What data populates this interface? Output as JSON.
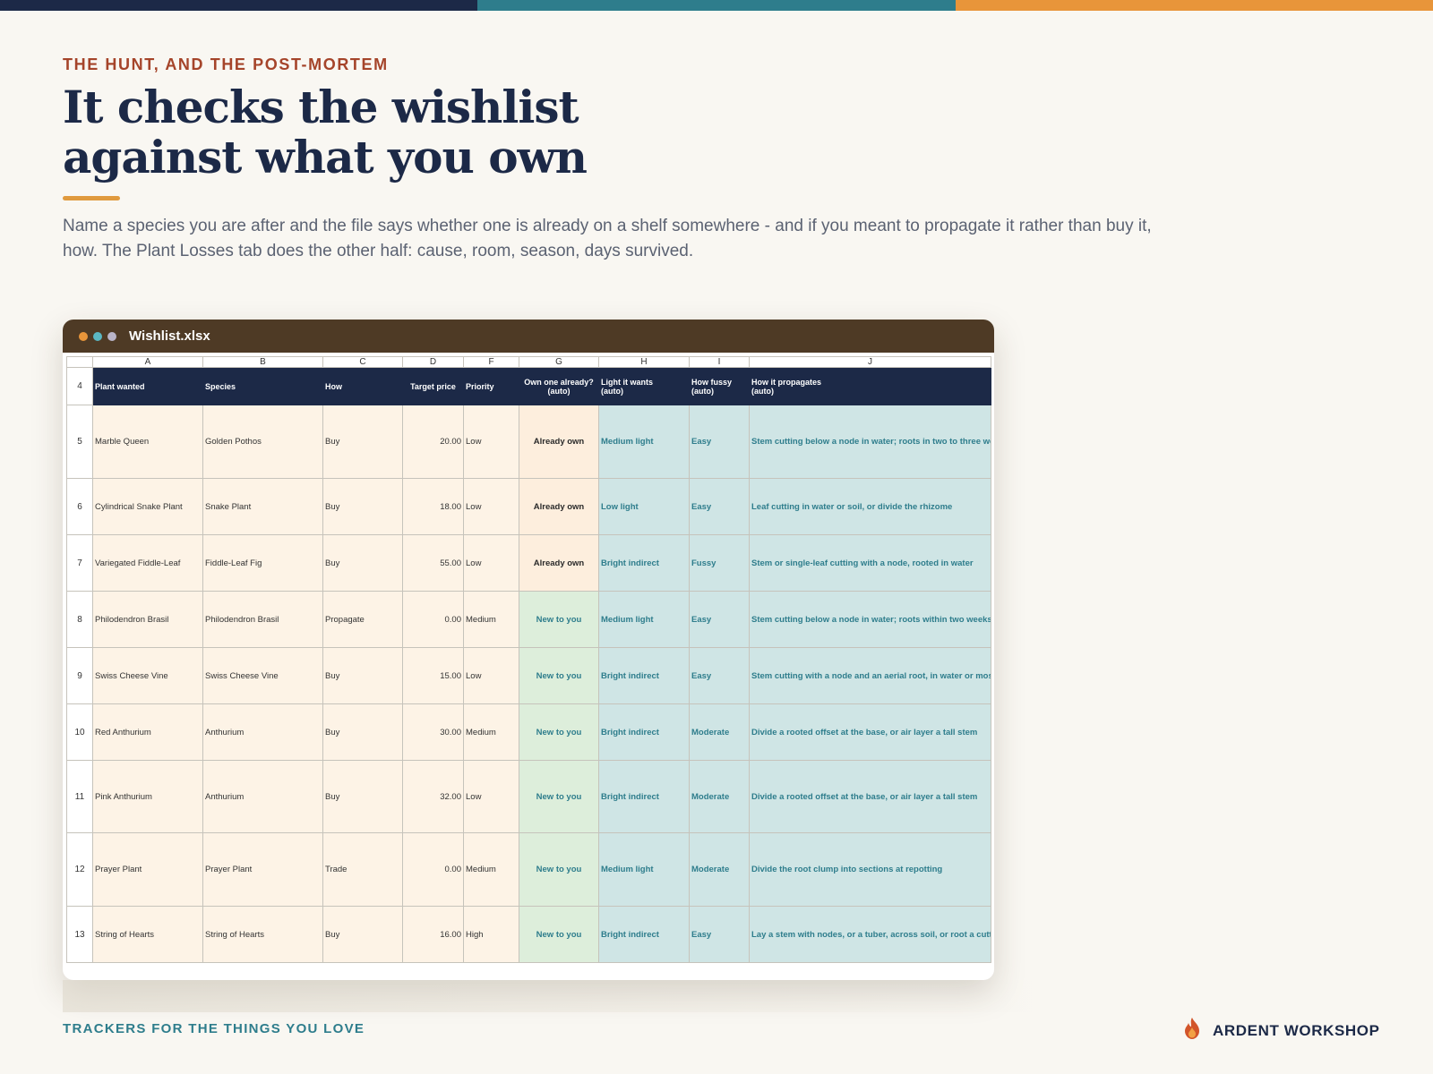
{
  "header": {
    "eyebrow": "THE HUNT, AND THE POST-MORTEM",
    "title_line1": "It checks the wishlist",
    "title_line2": "against what you own",
    "lead": "Name a species you are after and the file says whether one is already on a shelf somewhere - and if you meant to propagate it rather than buy it, how. The Plant Losses tab does the other half: cause, room, season, days survived."
  },
  "colors": {
    "navy": "#1c2947",
    "teal": "#2e7d8c",
    "orange": "#e8953a",
    "rust": "#a5442a",
    "titlebar": "#4e3a25"
  },
  "window": {
    "title": "Wishlist.xlsx",
    "dots": [
      "#e8953a",
      "#5bb8c4",
      "#b9b4c8"
    ]
  },
  "sheet": {
    "col_letters": [
      "A",
      "B",
      "C",
      "D",
      "F",
      "G",
      "H",
      "I",
      "J"
    ],
    "header_row_number": "4",
    "headers": [
      "Plant wanted",
      "Species",
      "How",
      "Target price",
      "Priority",
      "Own one already?\n(auto)",
      "Light it wants\n(auto)",
      "How fussy\n(auto)",
      "How it propagates\n(auto)"
    ],
    "rows": [
      {
        "n": "5",
        "plant": "Marble Queen",
        "species": "Golden Pothos",
        "how": "Buy",
        "price": "20.00",
        "priority": "Low",
        "own": "Already own",
        "light": "Medium light",
        "fussy": "Easy",
        "propagates": "Stem cutting below a node in water; roots in two to three weeks"
      },
      {
        "n": "6",
        "plant": "Cylindrical Snake Plant",
        "species": "Snake Plant",
        "how": "Buy",
        "price": "18.00",
        "priority": "Low",
        "own": "Already own",
        "light": "Low light",
        "fussy": "Easy",
        "propagates": "Leaf cutting in water or soil, or divide the rhizome"
      },
      {
        "n": "7",
        "plant": "Variegated Fiddle-Leaf",
        "species": "Fiddle-Leaf Fig",
        "how": "Buy",
        "price": "55.00",
        "priority": "Low",
        "own": "Already own",
        "light": "Bright indirect",
        "fussy": "Fussy",
        "propagates": "Stem or single-leaf cutting with a node, rooted in water"
      },
      {
        "n": "8",
        "plant": "Philodendron Brasil",
        "species": "Philodendron Brasil",
        "how": "Propagate",
        "price": "0.00",
        "priority": "Medium",
        "own": "New to you",
        "light": "Medium light",
        "fussy": "Easy",
        "propagates": "Stem cutting below a node in water; roots within two weeks"
      },
      {
        "n": "9",
        "plant": "Swiss Cheese Vine",
        "species": "Swiss Cheese Vine",
        "how": "Buy",
        "price": "15.00",
        "priority": "Low",
        "own": "New to you",
        "light": "Bright indirect",
        "fussy": "Easy",
        "propagates": "Stem cutting with a node and an aerial root, in water or moss"
      },
      {
        "n": "10",
        "plant": "Red Anthurium",
        "species": "Anthurium",
        "how": "Buy",
        "price": "30.00",
        "priority": "Medium",
        "own": "New to you",
        "light": "Bright indirect",
        "fussy": "Moderate",
        "propagates": "Divide a rooted offset at the base, or air layer a tall stem"
      },
      {
        "n": "11",
        "plant": "Pink Anthurium",
        "species": "Anthurium",
        "how": "Buy",
        "price": "32.00",
        "priority": "Low",
        "own": "New to you",
        "light": "Bright indirect",
        "fussy": "Moderate",
        "propagates": "Divide a rooted offset at the base, or air layer a tall stem"
      },
      {
        "n": "12",
        "plant": "Prayer Plant",
        "species": "Prayer Plant",
        "how": "Trade",
        "price": "0.00",
        "priority": "Medium",
        "own": "New to you",
        "light": "Medium light",
        "fussy": "Moderate",
        "propagates": "Divide the root clump into sections at repotting"
      },
      {
        "n": "13",
        "plant": "String of Hearts",
        "species": "String of Hearts",
        "how": "Buy",
        "price": "16.00",
        "priority": "High",
        "own": "New to you",
        "light": "Bright indirect",
        "fussy": "Easy",
        "propagates": "Lay a stem with nodes, or a tuber, across soil, or root a cutting i"
      }
    ]
  },
  "footer": {
    "tagline": "TRACKERS FOR THE THINGS YOU LOVE",
    "brand": "ARDENT WORKSHOP",
    "brand_icon": "flame-icon"
  }
}
